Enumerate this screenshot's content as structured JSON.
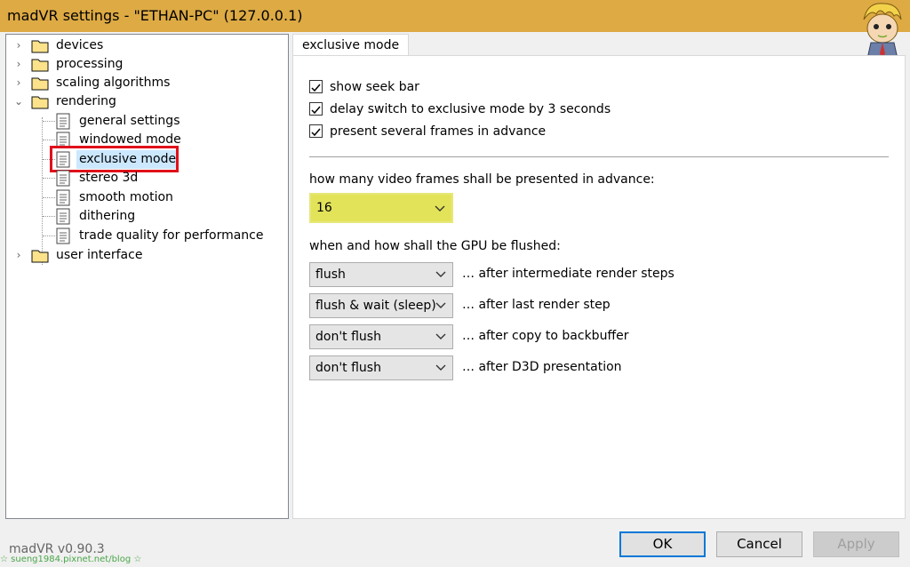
{
  "window": {
    "title": "madVR settings - \"ETHAN-PC\" (127.0.0.1)"
  },
  "tree": {
    "items": [
      {
        "label": "devices",
        "icon": "folder-icon",
        "expander": "›"
      },
      {
        "label": "processing",
        "icon": "folder-icon",
        "expander": "›"
      },
      {
        "label": "scaling algorithms",
        "icon": "folder-icon",
        "expander": "›"
      },
      {
        "label": "rendering",
        "icon": "folder-icon",
        "expander": "⌄"
      },
      {
        "label": "general settings",
        "icon": "page-icon"
      },
      {
        "label": "windowed mode",
        "icon": "page-icon"
      },
      {
        "label": "exclusive mode",
        "icon": "page-icon",
        "selected": true
      },
      {
        "label": "stereo 3d",
        "icon": "page-icon"
      },
      {
        "label": "smooth motion",
        "icon": "page-icon"
      },
      {
        "label": "dithering",
        "icon": "page-icon"
      },
      {
        "label": "trade quality for performance",
        "icon": "page-icon"
      },
      {
        "label": "user interface",
        "icon": "folder-icon",
        "expander": "›"
      }
    ]
  },
  "tab": {
    "label": "exclusive mode"
  },
  "checkboxes": [
    {
      "label": "show seek bar",
      "checked": true
    },
    {
      "label": "delay switch to exclusive mode by 3 seconds",
      "checked": true
    },
    {
      "label": "present several frames in advance",
      "checked": true
    }
  ],
  "frames_advance": {
    "label": "how many video frames shall be presented in advance:",
    "value": "16"
  },
  "flush": {
    "label": "when and how shall the GPU be flushed:",
    "rows": [
      {
        "value": "flush",
        "after": "… after intermediate render steps"
      },
      {
        "value": "flush & wait (sleep)",
        "after": "… after last render step"
      },
      {
        "value": "don't flush",
        "after": "… after copy to backbuffer"
      },
      {
        "value": "don't flush",
        "after": "… after D3D presentation"
      }
    ]
  },
  "footer": {
    "version": "madVR v0.90.3",
    "watermark": "☆ sueng1984.pixnet.net/blog ☆"
  },
  "buttons": {
    "ok": "OK",
    "cancel": "Cancel",
    "apply": "Apply"
  },
  "colors": {
    "titlebar": "#ddaa44",
    "selection_outline": "#e0101a",
    "highlight": "#e3e35a",
    "default_button_border": "#0078d7"
  }
}
